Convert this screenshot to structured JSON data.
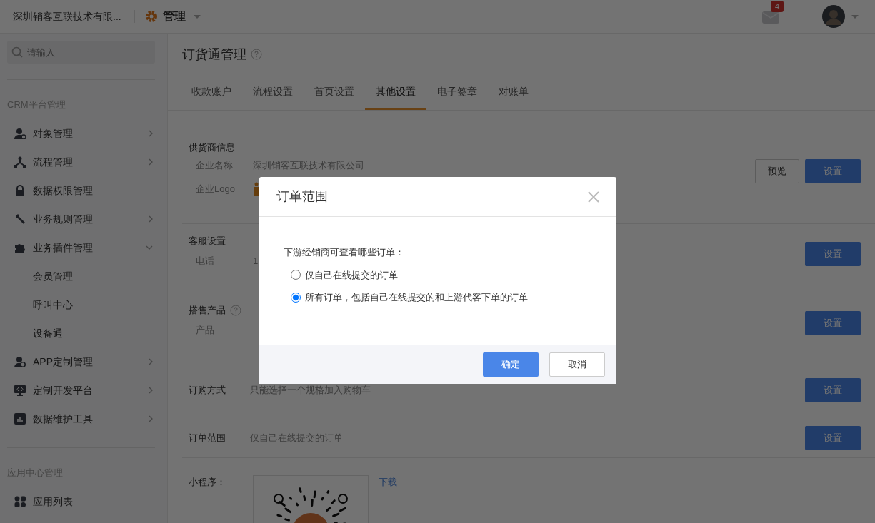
{
  "header": {
    "company": "深圳销客互联技术有限...",
    "title": "管理",
    "badge": "4"
  },
  "sidebar": {
    "search": {
      "placeholder": "请输入"
    },
    "sections": [
      {
        "title": "CRM平台管理",
        "items": [
          {
            "label": "对象管理",
            "expanded": false
          },
          {
            "label": "流程管理",
            "expanded": false
          },
          {
            "label": "数据权限管理"
          },
          {
            "label": "业务规则管理",
            "expanded": false
          },
          {
            "label": "业务插件管理",
            "expanded": true,
            "children": [
              {
                "label": "会员管理"
              },
              {
                "label": "呼叫中心"
              },
              {
                "label": "设备通"
              }
            ]
          },
          {
            "label": "APP定制管理",
            "expanded": false
          },
          {
            "label": "定制开发平台",
            "expanded": false
          },
          {
            "label": "数据维护工具",
            "expanded": false
          }
        ]
      },
      {
        "title": "应用中心管理",
        "items": [
          {
            "label": "应用列表"
          }
        ]
      }
    ]
  },
  "page": {
    "title": "订货通管理",
    "tabs": [
      {
        "label": "收款账户",
        "selected": false
      },
      {
        "label": "流程设置",
        "selected": false
      },
      {
        "label": "首页设置",
        "selected": false
      },
      {
        "label": "其他设置",
        "selected": true
      },
      {
        "label": "电子签章",
        "selected": false
      },
      {
        "label": "对账单",
        "selected": false
      }
    ],
    "sections": [
      {
        "kind": "group",
        "title": "供货商信息",
        "fields": [
          {
            "label": "企业名称",
            "value": "深圳销客互联技术有限公司"
          },
          {
            "label": "企业Logo",
            "kind": "logo"
          }
        ],
        "buttons": [
          {
            "label": "预览",
            "primary": false
          },
          {
            "label": "设置",
            "primary": true
          }
        ]
      },
      {
        "kind": "group",
        "title": "客服设置",
        "fields": [
          {
            "label": "电话",
            "value": "1"
          }
        ],
        "buttons": [
          {
            "label": "设置",
            "primary": true
          }
        ]
      },
      {
        "kind": "group",
        "title": "搭售产品",
        "help": true,
        "fields": [
          {
            "label": "产品"
          }
        ],
        "buttons": [
          {
            "label": "设置",
            "primary": true
          }
        ]
      },
      {
        "kind": "row",
        "title": "订购方式",
        "value": "只能选择一个规格加入购物车",
        "buttons": [
          {
            "label": "设置",
            "primary": true
          }
        ]
      },
      {
        "kind": "row",
        "title": "订单范围",
        "value": "仅自己在线提交的订单",
        "buttons": [
          {
            "label": "设置",
            "primary": true
          }
        ]
      },
      {
        "kind": "qr",
        "title": "小程序：",
        "link": "下载"
      }
    ]
  },
  "dialog": {
    "title": "订单范围",
    "prompt": "下游经销商可查看哪些订单：",
    "options": [
      {
        "label": "仅自己在线提交的订单",
        "selected": false
      },
      {
        "label": "所有订单，包括自己在线提交的和上游代客下单的订单",
        "selected": true
      }
    ],
    "buttons": [
      {
        "label": "确定",
        "primary": true
      },
      {
        "label": "取消",
        "primary": false
      }
    ]
  }
}
